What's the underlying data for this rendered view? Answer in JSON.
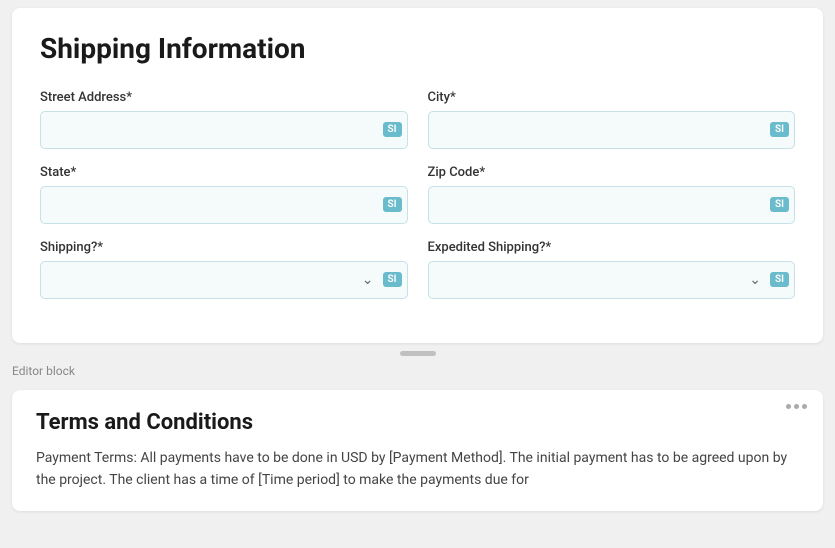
{
  "shipping": {
    "title": "Shipping Information",
    "fields": {
      "street_address": {
        "label": "Street Address*",
        "badge": "SI",
        "placeholder": ""
      },
      "city": {
        "label": "City*",
        "badge": "SI",
        "placeholder": ""
      },
      "state": {
        "label": "State*",
        "badge": "SI",
        "placeholder": ""
      },
      "zip_code": {
        "label": "Zip Code*",
        "badge": "SI",
        "placeholder": ""
      },
      "shipping": {
        "label": "Shipping?*",
        "badge": "SI",
        "placeholder": ""
      },
      "expedited_shipping": {
        "label": "Expedited Shipping?*",
        "badge": "SI",
        "placeholder": ""
      }
    }
  },
  "editor_block": {
    "label": "Editor block"
  },
  "terms": {
    "title": "Terms and Conditions",
    "text": "Payment Terms: All payments have to be done in USD by [Payment Method]. The initial payment has to be agreed upon by the project. The client has a time of [Time period] to make the payments due for"
  }
}
